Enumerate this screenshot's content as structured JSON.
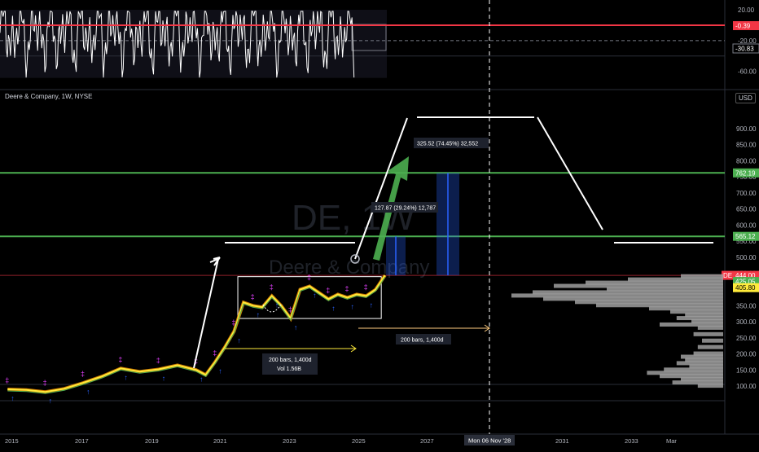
{
  "header": {
    "symbol_title": "Deere & Company, 1W, NYSE",
    "currency": "USD",
    "watermark_ticker": "DE, 1W",
    "watermark_name": "Deere & Company"
  },
  "oscillator": {
    "ticks": [
      "20.00",
      "-20.00",
      "-60.00"
    ],
    "current_value": "-0.39",
    "secondary_value": "-30.83"
  },
  "price_axis": {
    "ticks": [
      "900.00",
      "850.00",
      "800.00",
      "750.00",
      "700.00",
      "650.00",
      "600.00",
      "550.00",
      "500.00",
      "450.00",
      "400.00",
      "350.00",
      "300.00",
      "250.00",
      "200.00",
      "150.00",
      "100.00"
    ],
    "tags": [
      {
        "text": "762.19",
        "color": "#4caf50"
      },
      {
        "text": "565.12",
        "color": "#4caf50"
      },
      {
        "text": "444.00",
        "color": "#f23645"
      },
      {
        "text": "425.05",
        "color": "#4caf50"
      },
      {
        "text": "405.80",
        "color": "#ffeb3b"
      }
    ],
    "ticker_badge": "DE"
  },
  "time_axis": {
    "ticks": [
      "2015",
      "2017",
      "2019",
      "2021",
      "2023",
      "2025",
      "2027",
      "Mon 06 Nov '28",
      "2031",
      "2033",
      "Mar"
    ]
  },
  "annotations": {
    "range_box_bars": "200 bars, 1,400d",
    "range_box_vol": "Vol 1.56B",
    "projection_bars": "200 bars, 1,400d",
    "measure_short": "127.87 (29.24%) 12,787",
    "measure_long": "325.52 (74.45%) 32,552"
  },
  "colors": {
    "support_line": "#4caf50",
    "resistance_line": "#f23645",
    "measure_blue": "#2962ff",
    "arrow_green": "#4caf50",
    "projection_orange": "#ffcc80",
    "range_yellow": "#ffeb3b",
    "volume_profile": "#9e9e9e"
  },
  "chart_data": {
    "type": "line",
    "title": "Deere & Company, 1W, NYSE",
    "ylabel": "USD",
    "ylim": [
      80,
      940
    ],
    "xlim": [
      2014.8,
      2034.0
    ],
    "series": [
      {
        "values_x": [
          2015.0,
          2015.5,
          2016.0,
          2016.5,
          2017.0,
          2017.5,
          2018.0,
          2018.5,
          2019.0,
          2019.5,
          2020.0,
          2020.25,
          2020.5,
          2020.75,
          2021.0,
          2021.25,
          2021.5,
          2021.75,
          2022.0,
          2022.25,
          2022.5,
          2022.75,
          2023.0,
          2023.25,
          2023.5,
          2023.75,
          2024.0,
          2024.25,
          2024.5,
          2024.75,
          2025.0
        ],
        "values_y": [
          90,
          88,
          82,
          92,
          110,
          130,
          155,
          145,
          152,
          165,
          150,
          135,
          175,
          220,
          270,
          360,
          350,
          345,
          380,
          350,
          310,
          400,
          410,
          390,
          370,
          385,
          375,
          385,
          380,
          400,
          444
        ]
      }
    ],
    "horizontal_levels": [
      762.19,
      565.12,
      444.0
    ],
    "range_box": {
      "x_start": 2021.1,
      "x_end": 2024.9,
      "y_low": 310,
      "y_high": 440
    },
    "volume_profile": [
      {
        "price": 440,
        "volume": 0.2
      },
      {
        "price": 430,
        "volume": 0.45
      },
      {
        "price": 420,
        "volume": 0.65
      },
      {
        "price": 410,
        "volume": 0.8
      },
      {
        "price": 400,
        "volume": 0.55
      },
      {
        "price": 390,
        "volume": 0.9
      },
      {
        "price": 380,
        "volume": 1.0
      },
      {
        "price": 370,
        "volume": 0.85
      },
      {
        "price": 360,
        "volume": 0.7
      },
      {
        "price": 350,
        "volume": 0.6
      },
      {
        "price": 340,
        "volume": 0.35
      },
      {
        "price": 330,
        "volume": 0.25
      },
      {
        "price": 320,
        "volume": 0.18
      },
      {
        "price": 310,
        "volume": 0.22
      },
      {
        "price": 300,
        "volume": 0.15
      },
      {
        "price": 290,
        "volume": 0.3
      },
      {
        "price": 280,
        "volume": 0.12
      },
      {
        "price": 260,
        "volume": 0.14
      },
      {
        "price": 240,
        "volume": 0.1
      },
      {
        "price": 220,
        "volume": 0.12
      },
      {
        "price": 200,
        "volume": 0.14
      },
      {
        "price": 190,
        "volume": 0.2
      },
      {
        "price": 180,
        "volume": 0.18
      },
      {
        "price": 170,
        "volume": 0.22
      },
      {
        "price": 160,
        "volume": 0.16
      },
      {
        "price": 150,
        "volume": 0.28
      },
      {
        "price": 140,
        "volume": 0.36
      },
      {
        "price": 130,
        "volume": 0.3
      },
      {
        "price": 120,
        "volume": 0.2
      },
      {
        "price": 110,
        "volume": 0.24
      },
      {
        "price": 100,
        "volume": 0.12
      }
    ]
  }
}
